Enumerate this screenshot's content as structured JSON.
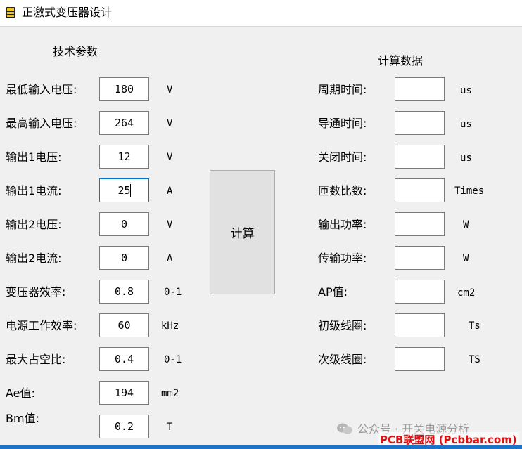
{
  "window": {
    "title": "正激式变压器设计"
  },
  "left": {
    "title": "技术参数",
    "rows": [
      {
        "label": "最低输入电压:",
        "value": "180",
        "unit": "V"
      },
      {
        "label": "最高输入电压:",
        "value": "264",
        "unit": "V"
      },
      {
        "label": "输出1电压:",
        "value": "12",
        "unit": "V"
      },
      {
        "label": "输出1电流:",
        "value": "25",
        "unit": "A"
      },
      {
        "label": "输出2电压:",
        "value": "0",
        "unit": "V"
      },
      {
        "label": "输出2电流:",
        "value": "0",
        "unit": "A"
      },
      {
        "label": "变压器效率:",
        "value": "0.8",
        "unit": "0-1"
      },
      {
        "label": "电源工作效率:",
        "value": "60",
        "unit": "kHz"
      },
      {
        "label": "最大占空比:",
        "value": "0.4",
        "unit": "0-1"
      },
      {
        "label": "Ae值:",
        "value": "194",
        "unit": "mm2"
      },
      {
        "label": "Bm值:",
        "value": "0.2",
        "unit": "T"
      }
    ]
  },
  "calculate_button": {
    "label": "计算"
  },
  "right": {
    "title": "计算数据",
    "rows": [
      {
        "label": "周期时间:",
        "value": "",
        "unit": "us"
      },
      {
        "label": "导通时间:",
        "value": "",
        "unit": "us"
      },
      {
        "label": "关闭时间:",
        "value": "",
        "unit": "us"
      },
      {
        "label": "匝数比数:",
        "value": "",
        "unit": "Times"
      },
      {
        "label": "输出功率:",
        "value": "",
        "unit": "W"
      },
      {
        "label": "传输功率:",
        "value": "",
        "unit": "W"
      },
      {
        "label": "AP值:",
        "value": "",
        "unit": "cm2"
      },
      {
        "label": "初级线圈:",
        "value": "",
        "unit": "Ts"
      },
      {
        "label": "次级线圈:",
        "value": "",
        "unit": "TS"
      }
    ]
  },
  "watermark": {
    "text": "公众号 · 开关电源分析",
    "site": "PCB联盟网 (Pcbbar.com)"
  },
  "colors": {
    "focus_border": "#0078d7",
    "window_border": "#1a73c8",
    "site_tag": "#e01010"
  },
  "icons": {
    "app": "app-icon",
    "watermark": "wechat-icon"
  }
}
